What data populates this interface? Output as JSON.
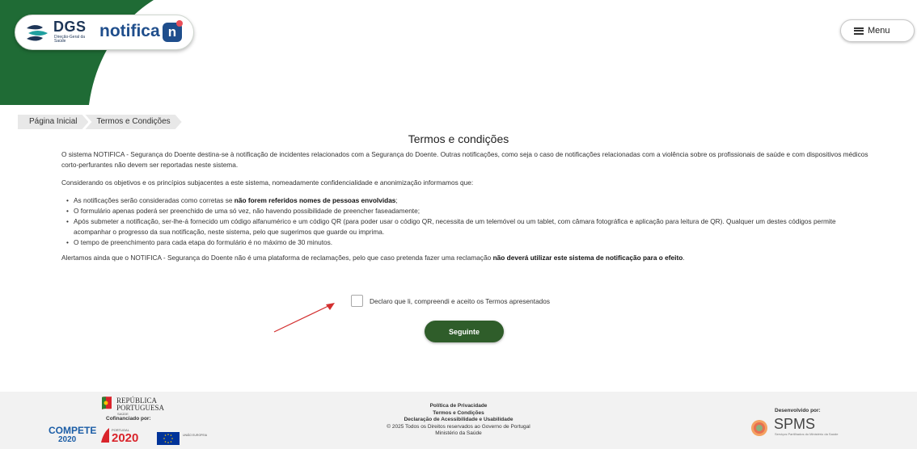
{
  "header": {
    "logo_dgs": "DGS",
    "logo_dgs_sub": "Direção-Geral da Saúde",
    "logo_notifica": "notifica",
    "logo_notifica_badge": "n",
    "menu_label": "Menu",
    "menu_icon": "hamburger-icon",
    "accent_green": "#1f6b35",
    "brand_blue": "#1f4e8c"
  },
  "breadcrumb": [
    "Página Inicial",
    "Termos e Condições"
  ],
  "page": {
    "title": "Termos e condições",
    "intro": "O sistema NOTIFICA - Segurança do Doente destina-se à notificação de incidentes relacionados com a Segurança do Doente. Outras notificações, como seja o caso de notificações relacionadas com a violência sobre os profissionais de saúde e com dispositivos médicos corto-perfurantes não devem ser reportadas neste sistema.",
    "considering": "Considerando os objetivos e os princípios subjacentes a este sistema, nomeadamente confidencialidade e anonimização informamos que:",
    "bullet_1_pre": "As notificações serão consideradas como corretas se ",
    "bullet_1_bold": "não forem referidos nomes de pessoas envolvidas",
    "bullet_1_post": ";",
    "bullet_2": "O formulário apenas poderá ser preenchido de uma só vez, não havendo possibilidade de preencher faseadamente;",
    "bullet_3": "Após submeter a notificação, ser-lhe-á fornecido um código alfanumérico e um código QR (para poder usar o código QR, necessita de um telemóvel ou um tablet, com câmara fotográfica e aplicação para leitura de QR). Qualquer um destes códigos permite acompanhar o progresso da sua notificação, neste sistema, pelo que sugerimos que guarde ou imprima.",
    "bullet_4": "O tempo de preenchimento para cada etapa do formulário é no máximo de 30 minutos.",
    "warning_pre": "Alertamos ainda que o NOTIFICA - Segurança do Doente não é uma plataforma de reclamações, pelo que caso pretenda fazer uma reclamação ",
    "warning_bold": "não deverá utilizar este sistema de notificação para o efeito",
    "warning_post": ".",
    "checkbox_label": "Declaro que li, compreendi e aceito os Termos apresentados",
    "checkbox_checked": false,
    "next_button": "Seguinte",
    "button_color": "#2f5d2a"
  },
  "footer": {
    "republica": "REPÚBLICA",
    "portuguesa": "PORTUGUESA",
    "saude": "SAÚDE",
    "cofinanciado": "Cofinanciado por:",
    "compete": "COMPETE",
    "compete_year": "2020",
    "portugal_small": "PORTUGAL",
    "p2020": "2020",
    "eu_label": "UNIÃO EUROPEIA",
    "links": [
      "Política de Privacidade",
      "Termos e Condições",
      "Declaração de Acessibilidade e Usabilidade"
    ],
    "copyright": "© 2025 Todos os Direitos reservados ao Governo de Portugal",
    "ministry": "Ministério da Saúde",
    "developed_by": "Desenvolvido por:",
    "spms": "SPMS",
    "spms_sub": "Serviços Partilhados do Ministério da Saúde"
  }
}
